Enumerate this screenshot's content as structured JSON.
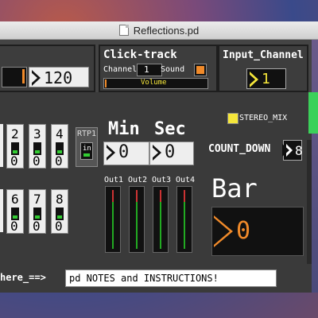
{
  "window": {
    "title": "Reflections.pd"
  },
  "tempo": {
    "value": "120"
  },
  "click_track": {
    "title": "Click-track",
    "channel_label": "Channel",
    "channel_value": "1",
    "sound_label": "Sound",
    "volume_label": "Volume"
  },
  "input_channel": {
    "title": "Input_Channel",
    "value": "1"
  },
  "track_slots": [
    {
      "num": "2",
      "val": "0"
    },
    {
      "num": "3",
      "val": "0"
    },
    {
      "num": "4",
      "val": "0"
    },
    {
      "num": "6",
      "val": "0"
    },
    {
      "num": "7",
      "val": "0"
    },
    {
      "num": "8",
      "val": "0"
    }
  ],
  "rtp": {
    "label": "RTP1",
    "toggle_text": "in"
  },
  "min": {
    "label": "Min",
    "value": "0"
  },
  "sec": {
    "label": "Sec",
    "value": "0"
  },
  "stereo_mix": {
    "label": "STEREO_MIX",
    "color": "#f5e63a"
  },
  "count_down": {
    "label": "COUNT_DOWN",
    "value": "8"
  },
  "outs": [
    "Out1",
    "Out2",
    "Out3",
    "Out4"
  ],
  "bar": {
    "label": "Bar",
    "value": "0",
    "color": "#f08a2a"
  },
  "notes": {
    "arrow_text": "here_==>",
    "button_text": "pd NOTES and INSTRUCTIONS!"
  }
}
